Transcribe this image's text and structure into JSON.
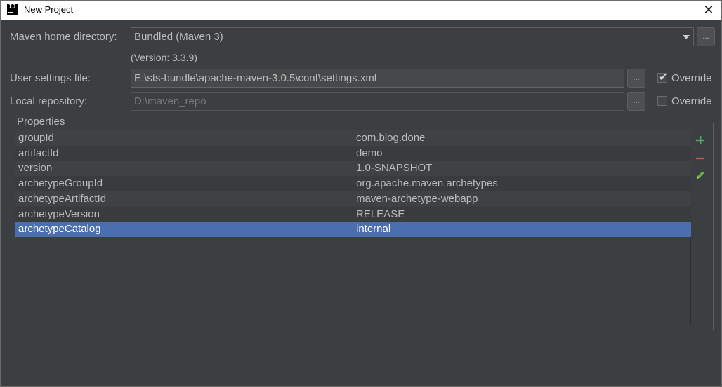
{
  "window": {
    "title": "New Project",
    "close_glyph": "✕"
  },
  "maven_home": {
    "label": "Maven home directory:",
    "value": "Bundled (Maven 3)",
    "version_note": "(Version: 3.3.9)",
    "browse_label": "..."
  },
  "user_settings": {
    "label": "User settings file:",
    "value": "E:\\sts-bundle\\apache-maven-3.0.5\\conf\\settings.xml",
    "browse_label": "...",
    "override_label": "Override",
    "override_checked": true
  },
  "local_repo": {
    "label": "Local repository:",
    "value": "D:\\maven_repo",
    "browse_label": "...",
    "override_label": "Override",
    "override_checked": false
  },
  "properties": {
    "legend": "Properties",
    "rows": [
      {
        "key": "groupId",
        "value": "com.blog.done"
      },
      {
        "key": "artifactId",
        "value": "demo"
      },
      {
        "key": "version",
        "value": "1.0-SNAPSHOT"
      },
      {
        "key": "archetypeGroupId",
        "value": "org.apache.maven.archetypes"
      },
      {
        "key": "archetypeArtifactId",
        "value": "maven-archetype-webapp"
      },
      {
        "key": "archetypeVersion",
        "value": "RELEASE"
      },
      {
        "key": "archetypeCatalog",
        "value": "internal"
      }
    ],
    "selected_row": 6,
    "tools": [
      "add-icon",
      "remove-icon",
      "edit-icon"
    ]
  },
  "colors": {
    "background": "#3c3f41",
    "selection": "#4b6eaf",
    "add_icon": "#59a869",
    "remove_icon": "#c75450",
    "edit_icon": "#62b543"
  }
}
